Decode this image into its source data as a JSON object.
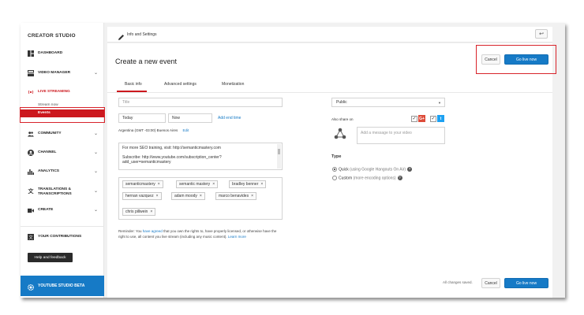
{
  "sidebar": {
    "brand": "CREATOR STUDIO",
    "items": [
      {
        "label": "DASHBOARD"
      },
      {
        "label": "VIDEO MANAGER"
      },
      {
        "label": "LIVE STREAMING"
      },
      {
        "label": "COMMUNITY"
      },
      {
        "label": "CHANNEL"
      },
      {
        "label": "ANALYTICS"
      },
      {
        "label": "TRANSLATIONS &",
        "label2": "TRANSCRIPTIONS"
      },
      {
        "label": "CREATE"
      },
      {
        "label": "YOUR CONTRIBUTIONS"
      }
    ],
    "sub_items": {
      "stream_now": "Stream now",
      "events": "Events"
    },
    "help_button": "Help and feedback",
    "beta_label": "YOUTUBE STUDIO BETA"
  },
  "topbar": {
    "title": "Info and Settings"
  },
  "header": {
    "title": "Create a new event",
    "cancel": "Cancel",
    "go_live": "Go live now"
  },
  "tabs": [
    "Basic info",
    "Advanced settings",
    "Monetization"
  ],
  "form": {
    "title_placeholder": "Title",
    "date_value": "Today",
    "time_value": "Now",
    "add_end_time": "Add end time",
    "timezone": "Argentina (GMT -03:00) Buenos Aires",
    "edit": "Edit",
    "description_line1": "For more SEO training, visit: http://semanticmastery.com",
    "description_line2": "Subscribe: http://www.youtube.com/subscription_center?",
    "description_line3": "add_user=semanticmastery",
    "tags": [
      "semanticmastery",
      "semantic mastery",
      "bradley benner",
      "hernan vazquez",
      "adam moody",
      "marco benavides",
      "chris pillwein"
    ],
    "reminder_pre": "Reminder: You ",
    "reminder_link": "have agreed",
    "reminder_mid": " that you own the rights to, have properly licensed, or otherwise have the",
    "reminder_line2": "right to use, all content you live stream (including any music content). ",
    "learn_more": "Learn more"
  },
  "right": {
    "privacy": "Public",
    "also_share": "Also share on",
    "message_placeholder": "Add a message to your video",
    "type_label": "Type",
    "quick": "Quick",
    "quick_desc": " (using Google Hangouts On Air)",
    "custom": "Custom",
    "custom_desc": " (more encoding options)"
  },
  "footer": {
    "status": "All changes saved.",
    "cancel": "Cancel",
    "go_live": "Go live now"
  },
  "colors": {
    "accent_red": "#cc181e",
    "accent_blue": "#167ac6",
    "annotation_red": "#d8232a"
  }
}
